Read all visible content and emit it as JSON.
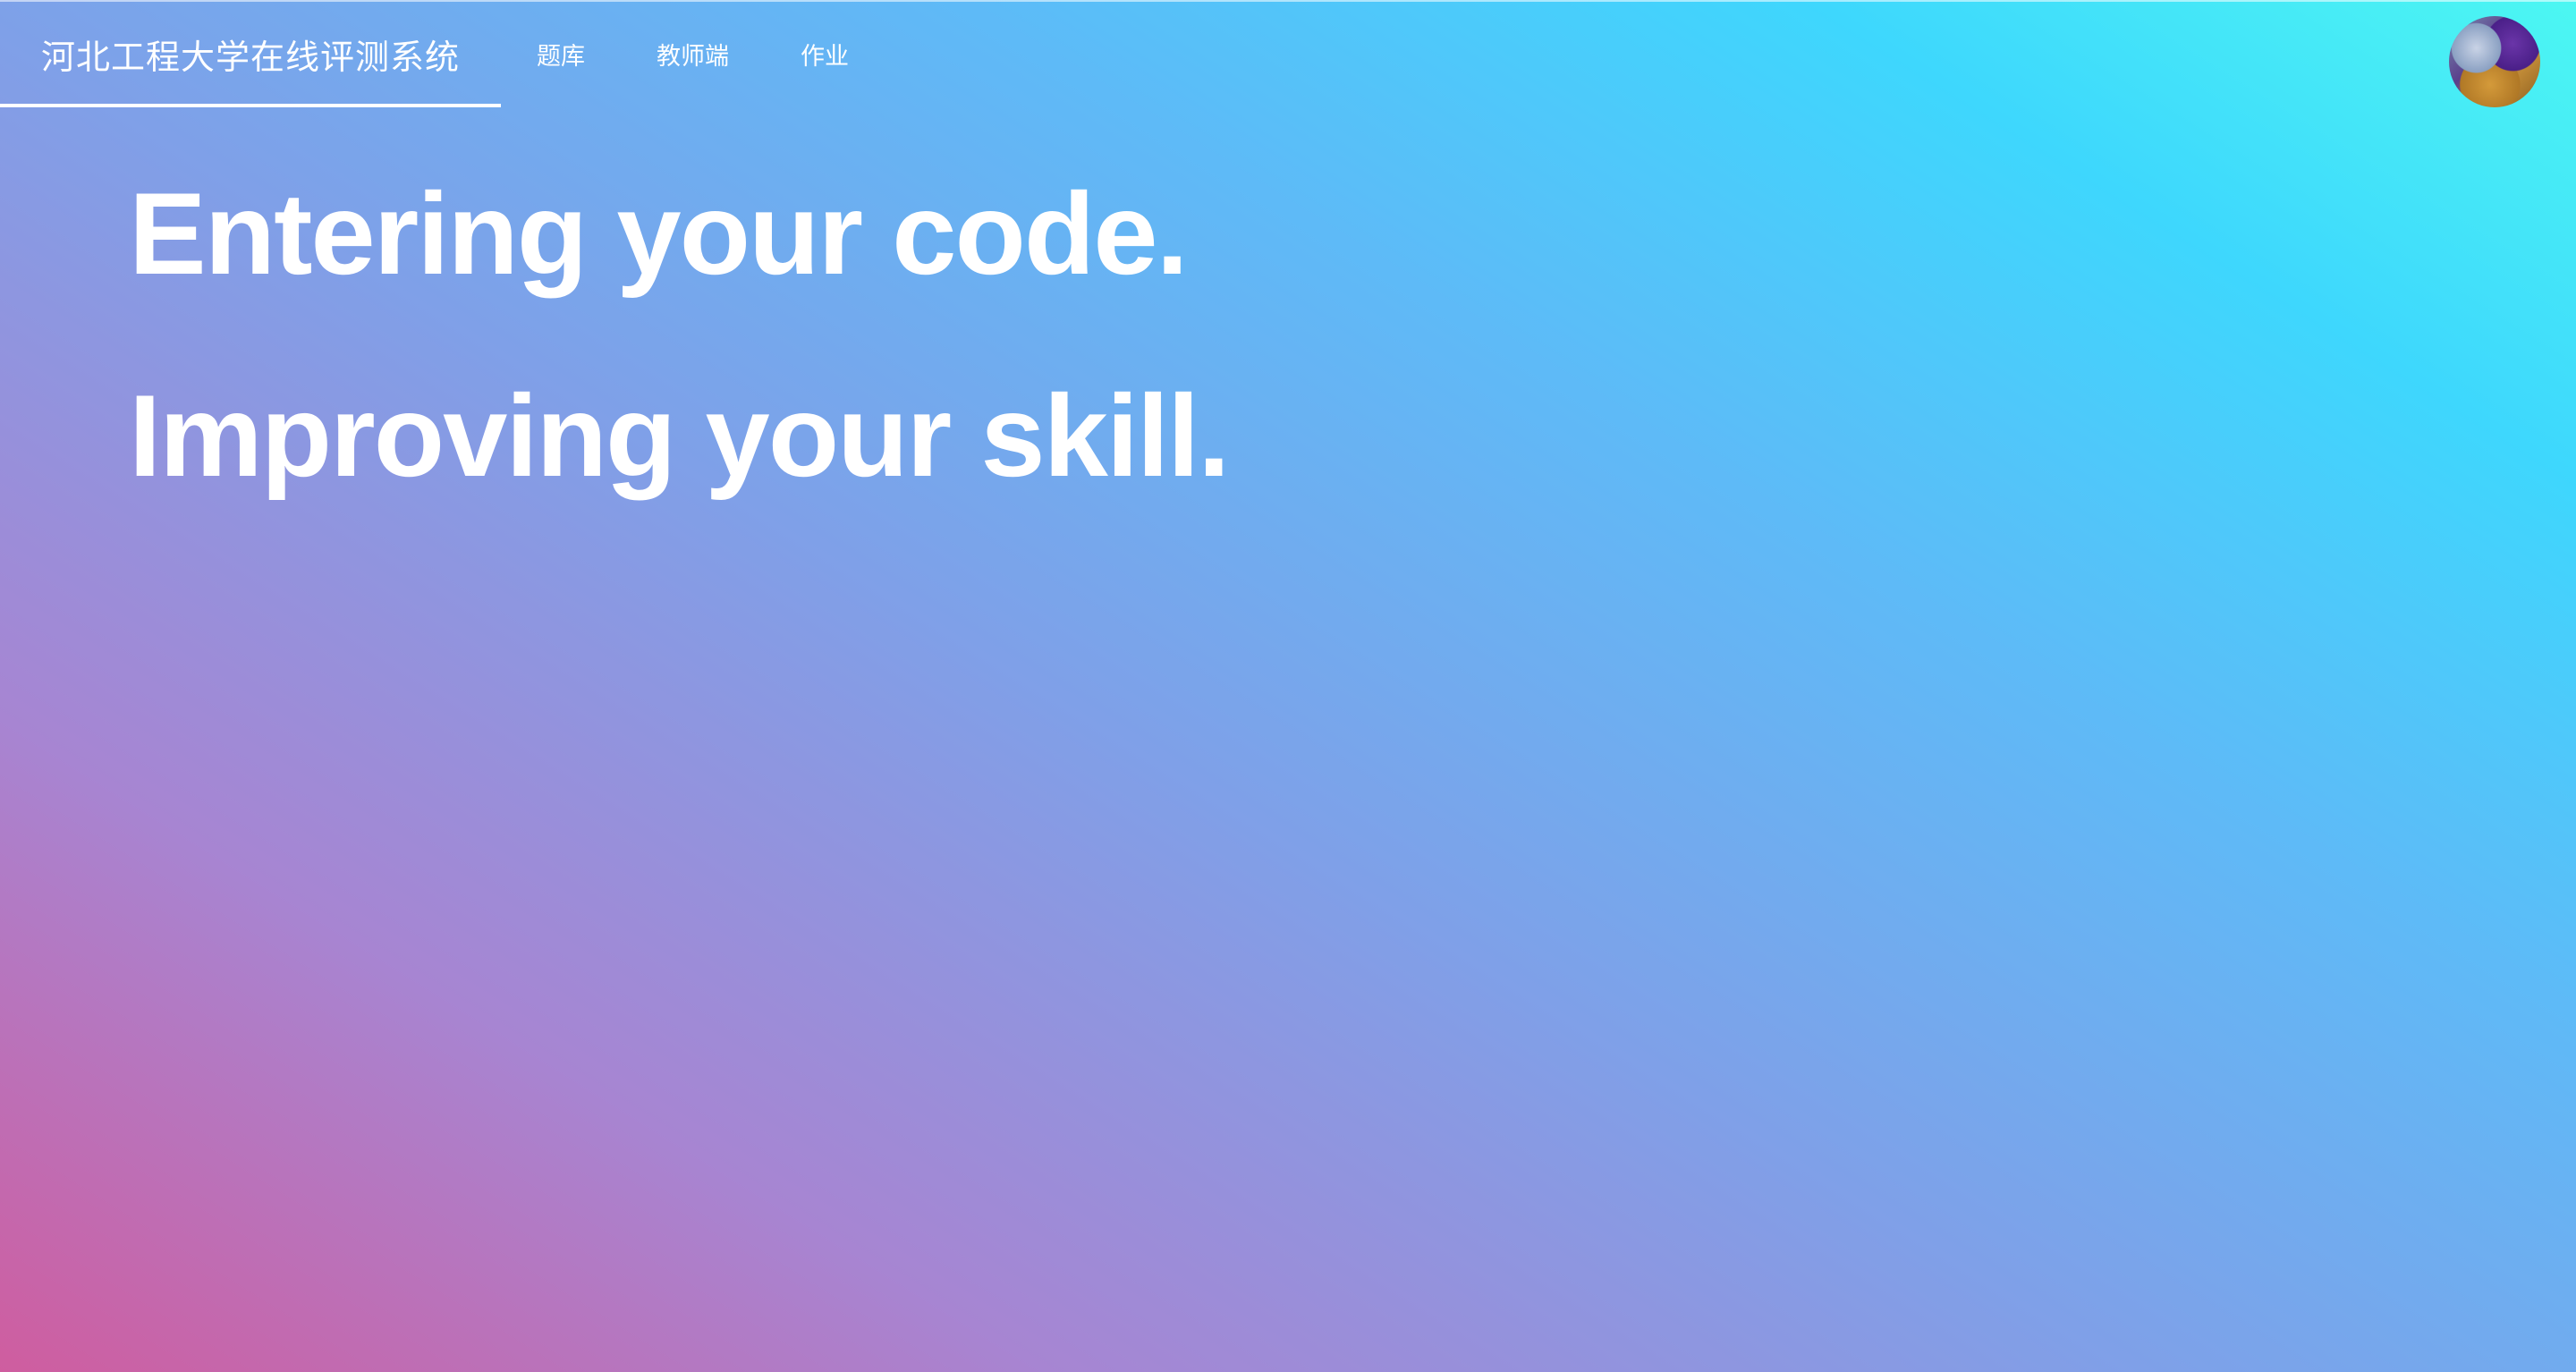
{
  "navbar": {
    "brand": "河北工程大学在线评测系统",
    "items": [
      {
        "label": "题库"
      },
      {
        "label": "教师端"
      },
      {
        "label": "作业"
      }
    ]
  },
  "user": {
    "avatar_icon": "user-avatar"
  },
  "hero": {
    "line1": "Entering your code.",
    "line2": "Improving your skill."
  },
  "colors": {
    "gradient_bottom_left": "#cf5d9f",
    "gradient_top_right": "#4cf7f2",
    "text": "#ffffff"
  }
}
